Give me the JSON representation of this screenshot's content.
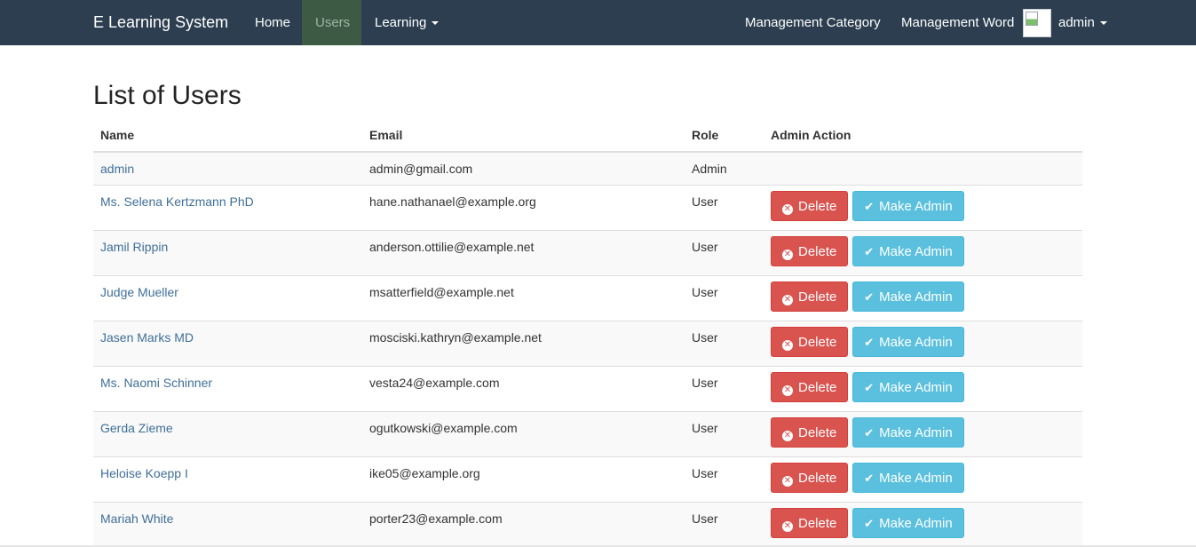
{
  "navbar": {
    "brand": "E Learning System",
    "left_items": [
      {
        "label": "Home"
      },
      {
        "label": "Users",
        "active": true
      },
      {
        "label": "Learning"
      }
    ],
    "right_items": [
      {
        "label": "Management Category"
      },
      {
        "label": "Management Word"
      }
    ],
    "user_menu": {
      "label": "admin",
      "avatar_icon": "broken-image-icon"
    },
    "colors": {
      "background": "#2c3e50",
      "active": "#3d5a45"
    }
  },
  "page": {
    "title": "List of Users"
  },
  "table": {
    "headers": {
      "name": "Name",
      "email": "Email",
      "role": "Role",
      "action": "Admin Action"
    },
    "rows": [
      {
        "name": "admin",
        "email": "admin@gmail.com",
        "role": "Admin"
      },
      {
        "name": "Ms. Selena Kertzmann PhD",
        "email": "hane.nathanael@example.org",
        "role": "User"
      },
      {
        "name": "Jamil Rippin",
        "email": "anderson.ottilie@example.net",
        "role": "User"
      },
      {
        "name": "Judge Mueller",
        "email": "msatterfield@example.net",
        "role": "User"
      },
      {
        "name": "Jasen Marks MD",
        "email": "mosciski.kathryn@example.net",
        "role": "User"
      },
      {
        "name": "Ms. Naomi Schinner",
        "email": "vesta24@example.com",
        "role": "User"
      },
      {
        "name": "Gerda Zieme",
        "email": "ogutkowski@example.com",
        "role": "User"
      },
      {
        "name": "Heloise Koepp I",
        "email": "ike05@example.org",
        "role": "User"
      },
      {
        "name": "Mariah White",
        "email": "porter23@example.com",
        "role": "User"
      }
    ],
    "actions": {
      "delete_label": "Delete",
      "make_admin_label": "Make Admin",
      "delete_icon": "times-circle-icon",
      "make_admin_icon": "check-icon",
      "delete_color": "#d9534f",
      "make_admin_color": "#5bc0de"
    }
  }
}
